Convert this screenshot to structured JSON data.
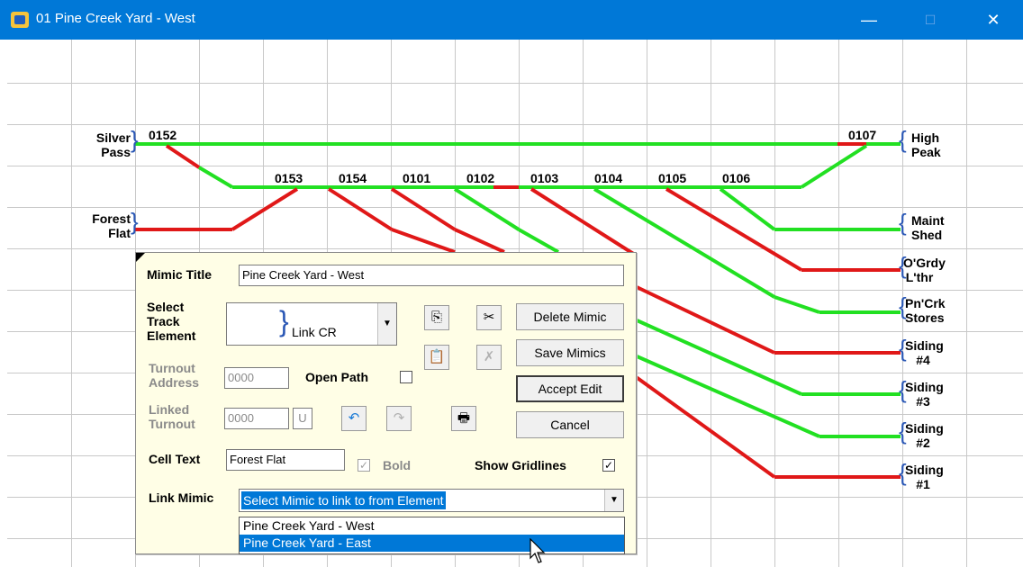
{
  "window": {
    "title": "01 Pine Creek Yard - West",
    "minimize_glyph": "—",
    "maximize_glyph": "☐",
    "close_glyph": "✕"
  },
  "colors": {
    "titlebar": "#0078d7",
    "track_green": "#22e022",
    "track_red": "#e01818",
    "dialog_bg": "#fffee6",
    "selection": "#0078d7"
  },
  "mimic": {
    "labels_left": {
      "silver_1": "Silver",
      "silver_2": "Pass",
      "forest_1": "Forest",
      "forest_2": "Flat"
    },
    "labels_right": {
      "high_1": "High",
      "high_2": "Peak",
      "maint_1": "Maint",
      "maint_2": "Shed",
      "ogrdy_1": "O'Grdy",
      "ogrdy_2": "L'thr",
      "pncrk_1": "Pn'Crk",
      "pncrk_2": "Stores",
      "s4_1": "Siding",
      "s4_2": "#4",
      "s3_1": "Siding",
      "s3_2": "#3",
      "s2_1": "Siding",
      "s2_2": "#2",
      "s1_1": "Siding",
      "s1_2": "#1"
    },
    "turnouts": {
      "t0152": "0152",
      "t0153": "0153",
      "t0154": "0154",
      "t0101": "0101",
      "t0102": "0102",
      "t0103": "0103",
      "t0104": "0104",
      "t0105": "0105",
      "t0106": "0106",
      "t0107": "0107"
    }
  },
  "dialog": {
    "mimic_title_label": "Mimic Title",
    "mimic_title_value": "Pine Creek Yard - West",
    "select_label_1": "Select",
    "select_label_2": "Track",
    "select_label_3": "Element",
    "element_value": "Link CR",
    "turnout_addr_label_1": "Turnout",
    "turnout_addr_label_2": "Address",
    "turnout_addr_value": "0000",
    "open_path_label": "Open Path",
    "linked_turnout_label_1": "Linked",
    "linked_turnout_label_2": "Turnout",
    "linked_turnout_value": "0000",
    "linked_turnout_suffix": "U",
    "cell_text_label": "Cell Text",
    "cell_text_value": "Forest Flat",
    "bold_label": "Bold",
    "show_gridlines_label": "Show Gridlines",
    "link_mimic_label": "Link Mimic",
    "link_mimic_value": "Select Mimic to link to from Element",
    "buttons": {
      "delete": "Delete Mimic",
      "save": "Save Mimics",
      "accept": "Accept Edit",
      "cancel": "Cancel"
    },
    "checkmark": "✓",
    "dropdown_arrow": "▼",
    "options": [
      "Pine Creek Yard - West",
      "Pine Creek Yard - East"
    ]
  }
}
